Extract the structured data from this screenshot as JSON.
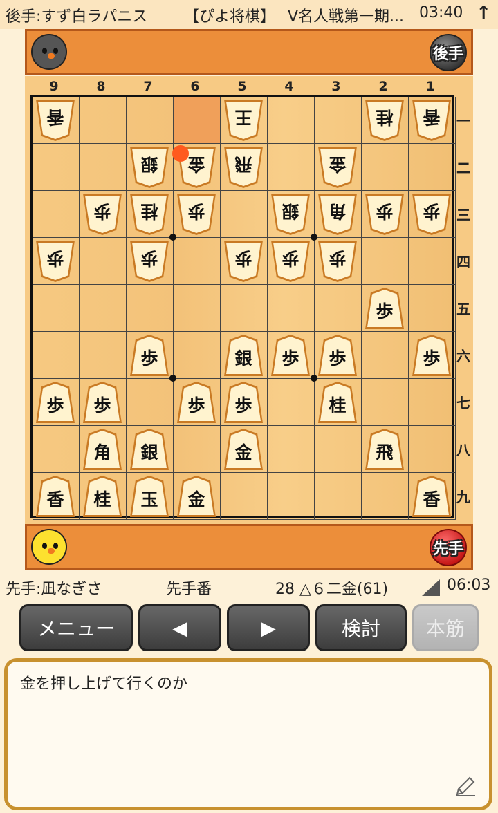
{
  "header": {
    "gote_player": "後手:すず白ラパニス",
    "app_name": "【ぴよ将棋】",
    "event": "V名人戦第一期...",
    "time": "03:40"
  },
  "sides": {
    "gote": "後手",
    "sente": "先手"
  },
  "board": {
    "files": [
      "9",
      "8",
      "7",
      "6",
      "5",
      "4",
      "3",
      "2",
      "1"
    ],
    "ranks": [
      "一",
      "二",
      "三",
      "四",
      "五",
      "六",
      "七",
      "八",
      "九"
    ],
    "last_move_square": {
      "file": 6,
      "rank": 1
    },
    "move_dot_square": {
      "file": 6,
      "rank": 2
    },
    "pieces": [
      {
        "file": 9,
        "rank": 1,
        "kanji": "香",
        "owner": "gote"
      },
      {
        "file": 5,
        "rank": 1,
        "kanji": "王",
        "owner": "gote"
      },
      {
        "file": 2,
        "rank": 1,
        "kanji": "桂",
        "owner": "gote"
      },
      {
        "file": 1,
        "rank": 1,
        "kanji": "香",
        "owner": "gote"
      },
      {
        "file": 7,
        "rank": 2,
        "kanji": "銀",
        "owner": "gote"
      },
      {
        "file": 6,
        "rank": 2,
        "kanji": "金",
        "owner": "gote"
      },
      {
        "file": 5,
        "rank": 2,
        "kanji": "飛",
        "owner": "gote"
      },
      {
        "file": 3,
        "rank": 2,
        "kanji": "金",
        "owner": "gote"
      },
      {
        "file": 8,
        "rank": 3,
        "kanji": "歩",
        "owner": "gote"
      },
      {
        "file": 7,
        "rank": 3,
        "kanji": "桂",
        "owner": "gote"
      },
      {
        "file": 6,
        "rank": 3,
        "kanji": "歩",
        "owner": "gote"
      },
      {
        "file": 4,
        "rank": 3,
        "kanji": "銀",
        "owner": "gote"
      },
      {
        "file": 3,
        "rank": 3,
        "kanji": "角",
        "owner": "gote"
      },
      {
        "file": 2,
        "rank": 3,
        "kanji": "歩",
        "owner": "gote"
      },
      {
        "file": 1,
        "rank": 3,
        "kanji": "歩",
        "owner": "gote"
      },
      {
        "file": 9,
        "rank": 4,
        "kanji": "歩",
        "owner": "gote"
      },
      {
        "file": 7,
        "rank": 4,
        "kanji": "歩",
        "owner": "gote"
      },
      {
        "file": 5,
        "rank": 4,
        "kanji": "歩",
        "owner": "gote"
      },
      {
        "file": 4,
        "rank": 4,
        "kanji": "歩",
        "owner": "gote"
      },
      {
        "file": 3,
        "rank": 4,
        "kanji": "歩",
        "owner": "gote"
      },
      {
        "file": 2,
        "rank": 5,
        "kanji": "歩",
        "owner": "sente"
      },
      {
        "file": 7,
        "rank": 6,
        "kanji": "歩",
        "owner": "sente"
      },
      {
        "file": 5,
        "rank": 6,
        "kanji": "銀",
        "owner": "sente"
      },
      {
        "file": 4,
        "rank": 6,
        "kanji": "歩",
        "owner": "sente"
      },
      {
        "file": 3,
        "rank": 6,
        "kanji": "歩",
        "owner": "sente"
      },
      {
        "file": 1,
        "rank": 6,
        "kanji": "歩",
        "owner": "sente"
      },
      {
        "file": 9,
        "rank": 7,
        "kanji": "歩",
        "owner": "sente"
      },
      {
        "file": 8,
        "rank": 7,
        "kanji": "歩",
        "owner": "sente"
      },
      {
        "file": 6,
        "rank": 7,
        "kanji": "歩",
        "owner": "sente"
      },
      {
        "file": 5,
        "rank": 7,
        "kanji": "歩",
        "owner": "sente"
      },
      {
        "file": 3,
        "rank": 7,
        "kanji": "桂",
        "owner": "sente"
      },
      {
        "file": 8,
        "rank": 8,
        "kanji": "角",
        "owner": "sente"
      },
      {
        "file": 7,
        "rank": 8,
        "kanji": "銀",
        "owner": "sente"
      },
      {
        "file": 5,
        "rank": 8,
        "kanji": "金",
        "owner": "sente"
      },
      {
        "file": 2,
        "rank": 8,
        "kanji": "飛",
        "owner": "sente"
      },
      {
        "file": 9,
        "rank": 9,
        "kanji": "香",
        "owner": "sente"
      },
      {
        "file": 8,
        "rank": 9,
        "kanji": "桂",
        "owner": "sente"
      },
      {
        "file": 7,
        "rank": 9,
        "kanji": "玉",
        "owner": "sente"
      },
      {
        "file": 6,
        "rank": 9,
        "kanji": "金",
        "owner": "sente"
      },
      {
        "file": 1,
        "rank": 9,
        "kanji": "香",
        "owner": "sente"
      }
    ]
  },
  "info": {
    "sente_player": "先手:凪なぎさ",
    "turn": "先手番",
    "move": "28 △６二金(61)",
    "time": "06:03"
  },
  "buttons": {
    "menu": "メニュー",
    "prev": "◀",
    "next": "▶",
    "analyze": "検討",
    "mainline": "本筋"
  },
  "comment": "金を押し上げて行くのか",
  "icons": {
    "upload": "upload-arrow-icon",
    "gote_avatar": "black-chick-icon",
    "sente_avatar": "yellow-chick-icon",
    "edit": "pencil-icon"
  },
  "colors": {
    "stand": "#ec8e3a",
    "board": "#f7ca84",
    "highlight": "#f0a05a",
    "move_dot": "#ff5a1e"
  }
}
